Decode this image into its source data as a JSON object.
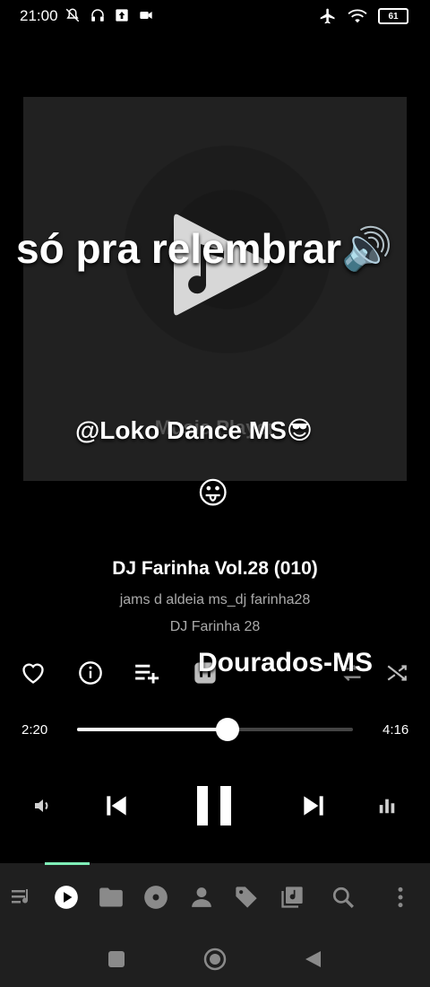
{
  "status_bar": {
    "time": "21:00",
    "battery": "61"
  },
  "album_art": {
    "faint_text": "Music Player"
  },
  "overlays": {
    "line1": "só pra relembrar🔊",
    "line2": "@Loko Dance MS😎",
    "line3": "😛",
    "line4": "Dourados-MS"
  },
  "track": {
    "title": "DJ Farinha Vol.28 (010)",
    "artist": "jams d aldeia ms_dj farinha28",
    "album": "DJ Farinha 28"
  },
  "actions": [
    "heart-icon",
    "info-icon",
    "add-to-playlist-icon",
    "equalizer-icon",
    "repeat-icon",
    "shuffle-icon"
  ],
  "progress": {
    "current": "2:20",
    "total": "4:16",
    "fraction": 0.547
  },
  "colors": {
    "accent": "#7ff0b8",
    "background": "#000000",
    "nav_background": "#1f1f1f"
  },
  "bottom_nav": [
    "queue-icon",
    "now-playing-icon",
    "folder-icon",
    "album-icon",
    "artist-icon",
    "tag-icon",
    "playlist-icon",
    "search-icon",
    "more-icon"
  ]
}
